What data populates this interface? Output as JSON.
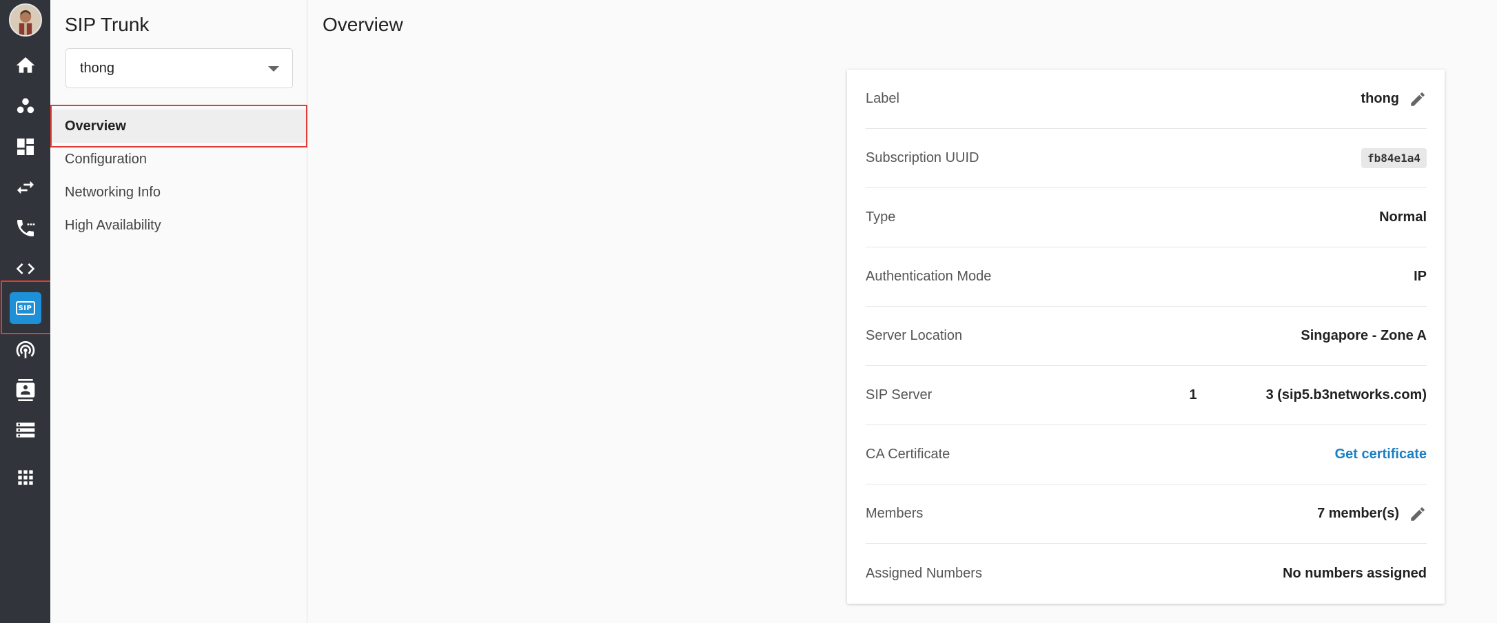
{
  "rail": {
    "items": [
      {
        "name": "home-icon"
      },
      {
        "name": "team-icon"
      },
      {
        "name": "dashboard-icon"
      },
      {
        "name": "transfer-icon"
      },
      {
        "name": "phone-icon"
      },
      {
        "name": "code-icon"
      },
      {
        "name": "sip-icon",
        "label": "SIP",
        "active": true
      },
      {
        "name": "broadcast-icon"
      },
      {
        "name": "contacts-icon"
      },
      {
        "name": "storage-icon"
      },
      {
        "name": "apps-grid-icon"
      }
    ],
    "accent": "#1e90d8",
    "highlight_color": "#e53935"
  },
  "sidenav": {
    "title": "SIP Trunk",
    "select_value": "thong",
    "items": [
      {
        "label": "Overview",
        "active": true
      },
      {
        "label": "Configuration"
      },
      {
        "label": "Networking Info"
      },
      {
        "label": "High Availability"
      }
    ]
  },
  "main": {
    "title": "Overview",
    "details": {
      "label": {
        "label": "Label",
        "value": "thong"
      },
      "subscription": {
        "label": "Subscription UUID",
        "value": "fb84e1a4"
      },
      "type": {
        "label": "Type",
        "value": "Normal"
      },
      "auth": {
        "label": "Authentication Mode",
        "value": "IP"
      },
      "location": {
        "label": "Server Location",
        "value": "Singapore - Zone A"
      },
      "sip_server": {
        "label": "SIP Server",
        "index": "1",
        "value": "3 (sip5.b3networks.com)"
      },
      "ca": {
        "label": "CA Certificate",
        "value": "Get certificate"
      },
      "members": {
        "label": "Members",
        "value": "7 member(s)"
      },
      "numbers": {
        "label": "Assigned Numbers",
        "value": "No numbers assigned"
      }
    },
    "link_color": "#1b7fc4"
  }
}
